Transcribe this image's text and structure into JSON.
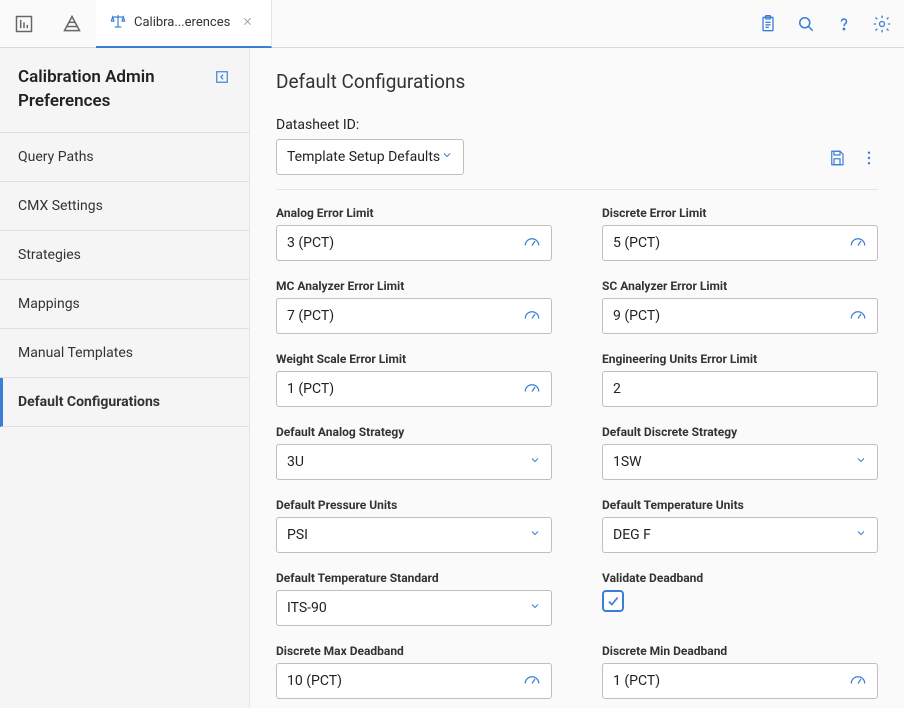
{
  "toolbar": {
    "tabs": [
      {
        "label": "Calibra...erences"
      }
    ]
  },
  "sidebar": {
    "title": "Calibration Admin Preferences",
    "items": [
      {
        "label": "Query Paths"
      },
      {
        "label": "CMX Settings"
      },
      {
        "label": "Strategies"
      },
      {
        "label": "Mappings"
      },
      {
        "label": "Manual Templates"
      },
      {
        "label": "Default Configurations",
        "active": true
      }
    ]
  },
  "page": {
    "title": "Default Configurations",
    "datasheet_label": "Datasheet ID:",
    "datasheet_value": "Template Setup Defaults"
  },
  "fields": {
    "analog_error_limit": {
      "label": "Analog Error Limit",
      "value": "3 (PCT)"
    },
    "discrete_error_limit": {
      "label": "Discrete Error Limit",
      "value": "5 (PCT)"
    },
    "mc_analyzer_error_limit": {
      "label": "MC Analyzer Error Limit",
      "value": "7 (PCT)"
    },
    "sc_analyzer_error_limit": {
      "label": "SC Analyzer Error Limit",
      "value": "9 (PCT)"
    },
    "weight_scale_error_limit": {
      "label": "Weight Scale Error Limit",
      "value": "1 (PCT)"
    },
    "engineering_units_error_limit": {
      "label": "Engineering Units Error Limit",
      "value": "2"
    },
    "default_analog_strategy": {
      "label": "Default Analog Strategy",
      "value": "3U"
    },
    "default_discrete_strategy": {
      "label": "Default Discrete Strategy",
      "value": "1SW"
    },
    "default_pressure_units": {
      "label": "Default Pressure Units",
      "value": "PSI"
    },
    "default_temperature_units": {
      "label": "Default Temperature Units",
      "value": "DEG F"
    },
    "default_temperature_standard": {
      "label": "Default Temperature Standard",
      "value": "ITS-90"
    },
    "validate_deadband": {
      "label": "Validate Deadband",
      "checked": true
    },
    "discrete_max_deadband": {
      "label": "Discrete Max Deadband",
      "value": "10 (PCT)"
    },
    "discrete_min_deadband": {
      "label": "Discrete Min Deadband",
      "value": "1 (PCT)"
    }
  }
}
